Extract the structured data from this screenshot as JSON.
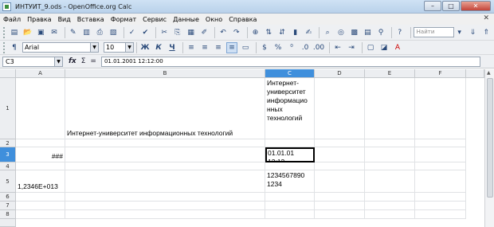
{
  "window": {
    "title": "ИНТУИТ_9.ods - OpenOffice.org Calc",
    "minimize_label": "–",
    "maximize_label": "□",
    "close_label": "✕"
  },
  "menubar": {
    "items": [
      "Файл",
      "Правка",
      "Вид",
      "Вставка",
      "Формат",
      "Сервис",
      "Данные",
      "Окно",
      "Справка"
    ],
    "close_doc": "✕"
  },
  "toolbar": {
    "find_placeholder": "Найти"
  },
  "formatting": {
    "font_name": "Arial",
    "font_size": "10"
  },
  "formula_bar": {
    "cell_ref": "C3",
    "fx": "fx",
    "sum": "Σ",
    "equals": "=",
    "content": "01.01.2001 12:12:00"
  },
  "sheet": {
    "columns": [
      "A",
      "B",
      "C",
      "D",
      "E",
      "F"
    ],
    "selected_column": "C",
    "rows": [
      "1",
      "2",
      "3",
      "4",
      "5",
      "6",
      "7",
      "8"
    ],
    "selected_row": "3",
    "cells": {
      "A3": "###",
      "A5": "1,2346E+013",
      "B1": "Интернет-университет информационных технологий",
      "C1": "Интернет-\nуниверситет\nинформацио\nнных\nтехнологий",
      "C3": "01.01.01\n12:12",
      "C5": "1234567890\n1234"
    }
  },
  "colors": {
    "selection": "#3f8fdc",
    "header_bg": "#eceef1"
  }
}
